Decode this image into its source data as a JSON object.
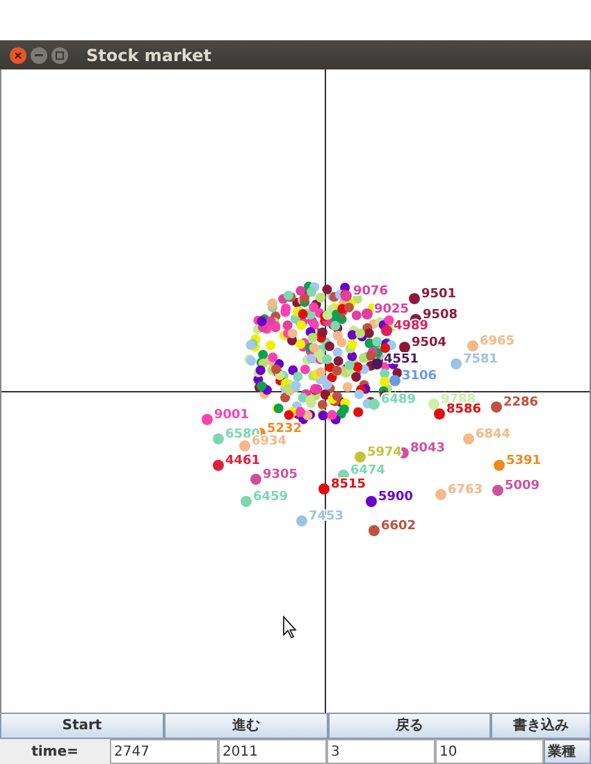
{
  "window": {
    "title": "Stock market"
  },
  "plot": {
    "points": [
      {
        "label": "9076",
        "color": "#e040a0"
      },
      {
        "label": "9025",
        "color": "#e040a0"
      },
      {
        "label": "9501",
        "color": "#8b1a3a"
      },
      {
        "label": "9508",
        "color": "#8b1a3a"
      },
      {
        "label": "4989",
        "color": "#e0205a"
      },
      {
        "label": "9504",
        "color": "#8b1a3a"
      },
      {
        "label": "6965",
        "color": "#f5b88a"
      },
      {
        "label": "7581",
        "color": "#9cc4e6"
      },
      {
        "label": "4551",
        "color": "#4a1a5a"
      },
      {
        "label": "3106",
        "color": "#6a9ae0"
      },
      {
        "label": "6489",
        "color": "#7dd8b0"
      },
      {
        "label": "9788",
        "color": "#c8f0a8"
      },
      {
        "label": "8586",
        "color": "#e01010"
      },
      {
        "label": "2286",
        "color": "#c05040"
      },
      {
        "label": "6844",
        "color": "#f5b88a"
      },
      {
        "label": "8043",
        "color": "#d050a0"
      },
      {
        "label": "5391",
        "color": "#f08a20"
      },
      {
        "label": "5009",
        "color": "#d050a0"
      },
      {
        "label": "6763",
        "color": "#f5b88a"
      },
      {
        "label": "9001",
        "color": "#ff40b0"
      },
      {
        "label": "6580",
        "color": "#7dd8b0"
      },
      {
        "label": "5232",
        "color": "#f08a20"
      },
      {
        "label": "6934",
        "color": "#f5b88a"
      },
      {
        "label": "4461",
        "color": "#e0203a"
      },
      {
        "label": "9305",
        "color": "#d050a0"
      },
      {
        "label": "8515",
        "color": "#e01010"
      },
      {
        "label": "6459",
        "color": "#7dd8b0"
      },
      {
        "label": "5974",
        "color": "#c4c43a"
      },
      {
        "label": "6474",
        "color": "#7dd8b0"
      },
      {
        "label": "7453",
        "color": "#9cc4e6"
      },
      {
        "label": "5900",
        "color": "#6a00c8"
      },
      {
        "label": "6602",
        "color": "#c05040"
      }
    ]
  },
  "buttons": [
    "Start",
    "進む",
    "戻る",
    "書き込み"
  ],
  "time_row": {
    "label": "time=",
    "fields": [
      "2747",
      "2011",
      "3",
      "10"
    ],
    "category_button": "業種"
  }
}
